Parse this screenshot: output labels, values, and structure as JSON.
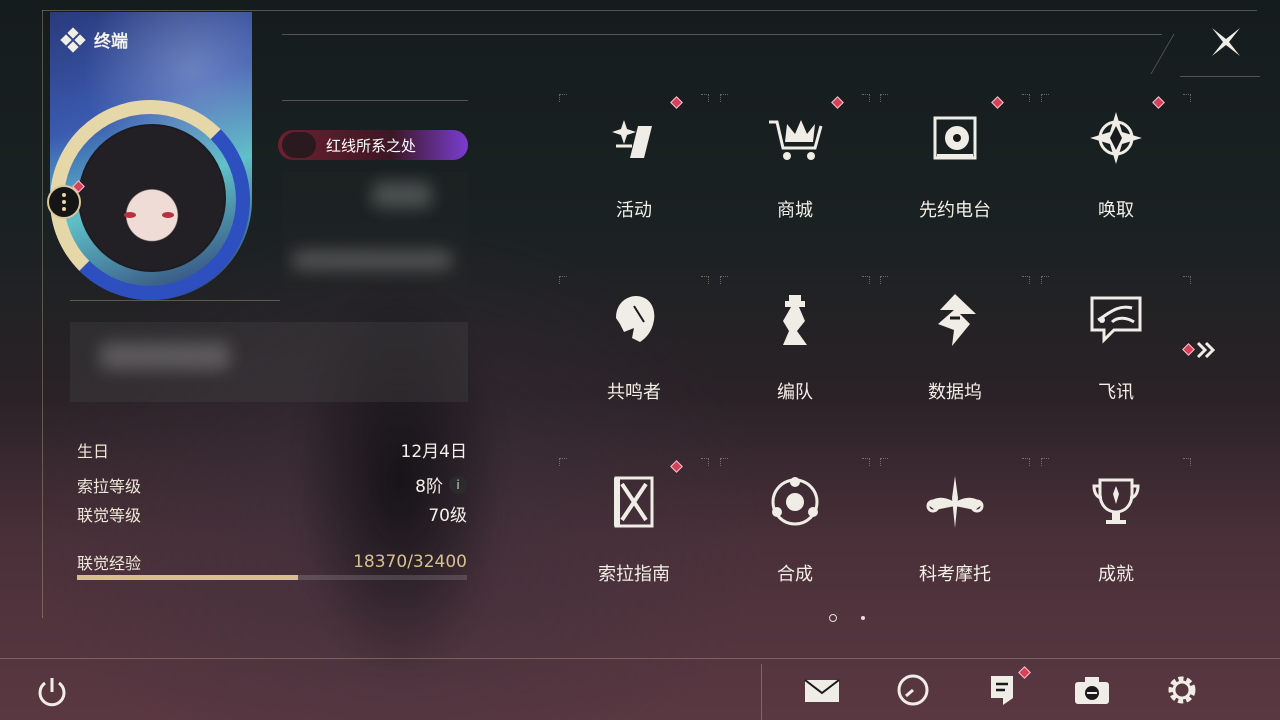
{
  "window": {
    "title": "终端"
  },
  "profile": {
    "name_tag": "红线所系之处",
    "stats": [
      {
        "label": "生日",
        "value": "12月4日"
      },
      {
        "label": "索拉等级",
        "value": "8阶"
      },
      {
        "label": "联觉等级",
        "value": "70级"
      },
      {
        "label": "联觉经验",
        "value": "18370/32400"
      }
    ],
    "exp_progress": 0.567
  },
  "grid": [
    {
      "label": "活动",
      "icon": "sparkle-icon",
      "badge": true
    },
    {
      "label": "商城",
      "icon": "cart-crown-icon",
      "badge": true
    },
    {
      "label": "先约电台",
      "icon": "radio-vinyl-icon",
      "badge": true
    },
    {
      "label": "唤取",
      "icon": "compass-star-icon",
      "badge": true
    },
    {
      "label": "共鸣者",
      "icon": "character-head-icon",
      "badge": false
    },
    {
      "label": "编队",
      "icon": "chess-piece-icon",
      "badge": false
    },
    {
      "label": "数据坞",
      "icon": "data-dock-icon",
      "badge": false
    },
    {
      "label": "飞讯",
      "icon": "chat-message-icon",
      "badge": false
    },
    {
      "label": "索拉指南",
      "icon": "guide-book-icon",
      "badge": true
    },
    {
      "label": "合成",
      "icon": "synthesis-icon",
      "badge": false
    },
    {
      "label": "科考摩托",
      "icon": "motorbike-icon",
      "badge": false
    },
    {
      "label": "成就",
      "icon": "trophy-icon",
      "badge": false
    }
  ],
  "pagination": {
    "current": 1,
    "total": 2
  },
  "bottom": {
    "left": [
      "power-icon"
    ],
    "right": [
      "mail-icon",
      "clock-icon",
      "notice-icon",
      "camera-icon",
      "settings-icon"
    ]
  },
  "colors": {
    "accent": "#e6d7a8",
    "badge": "#d6405a",
    "text": "#f2efe7"
  }
}
